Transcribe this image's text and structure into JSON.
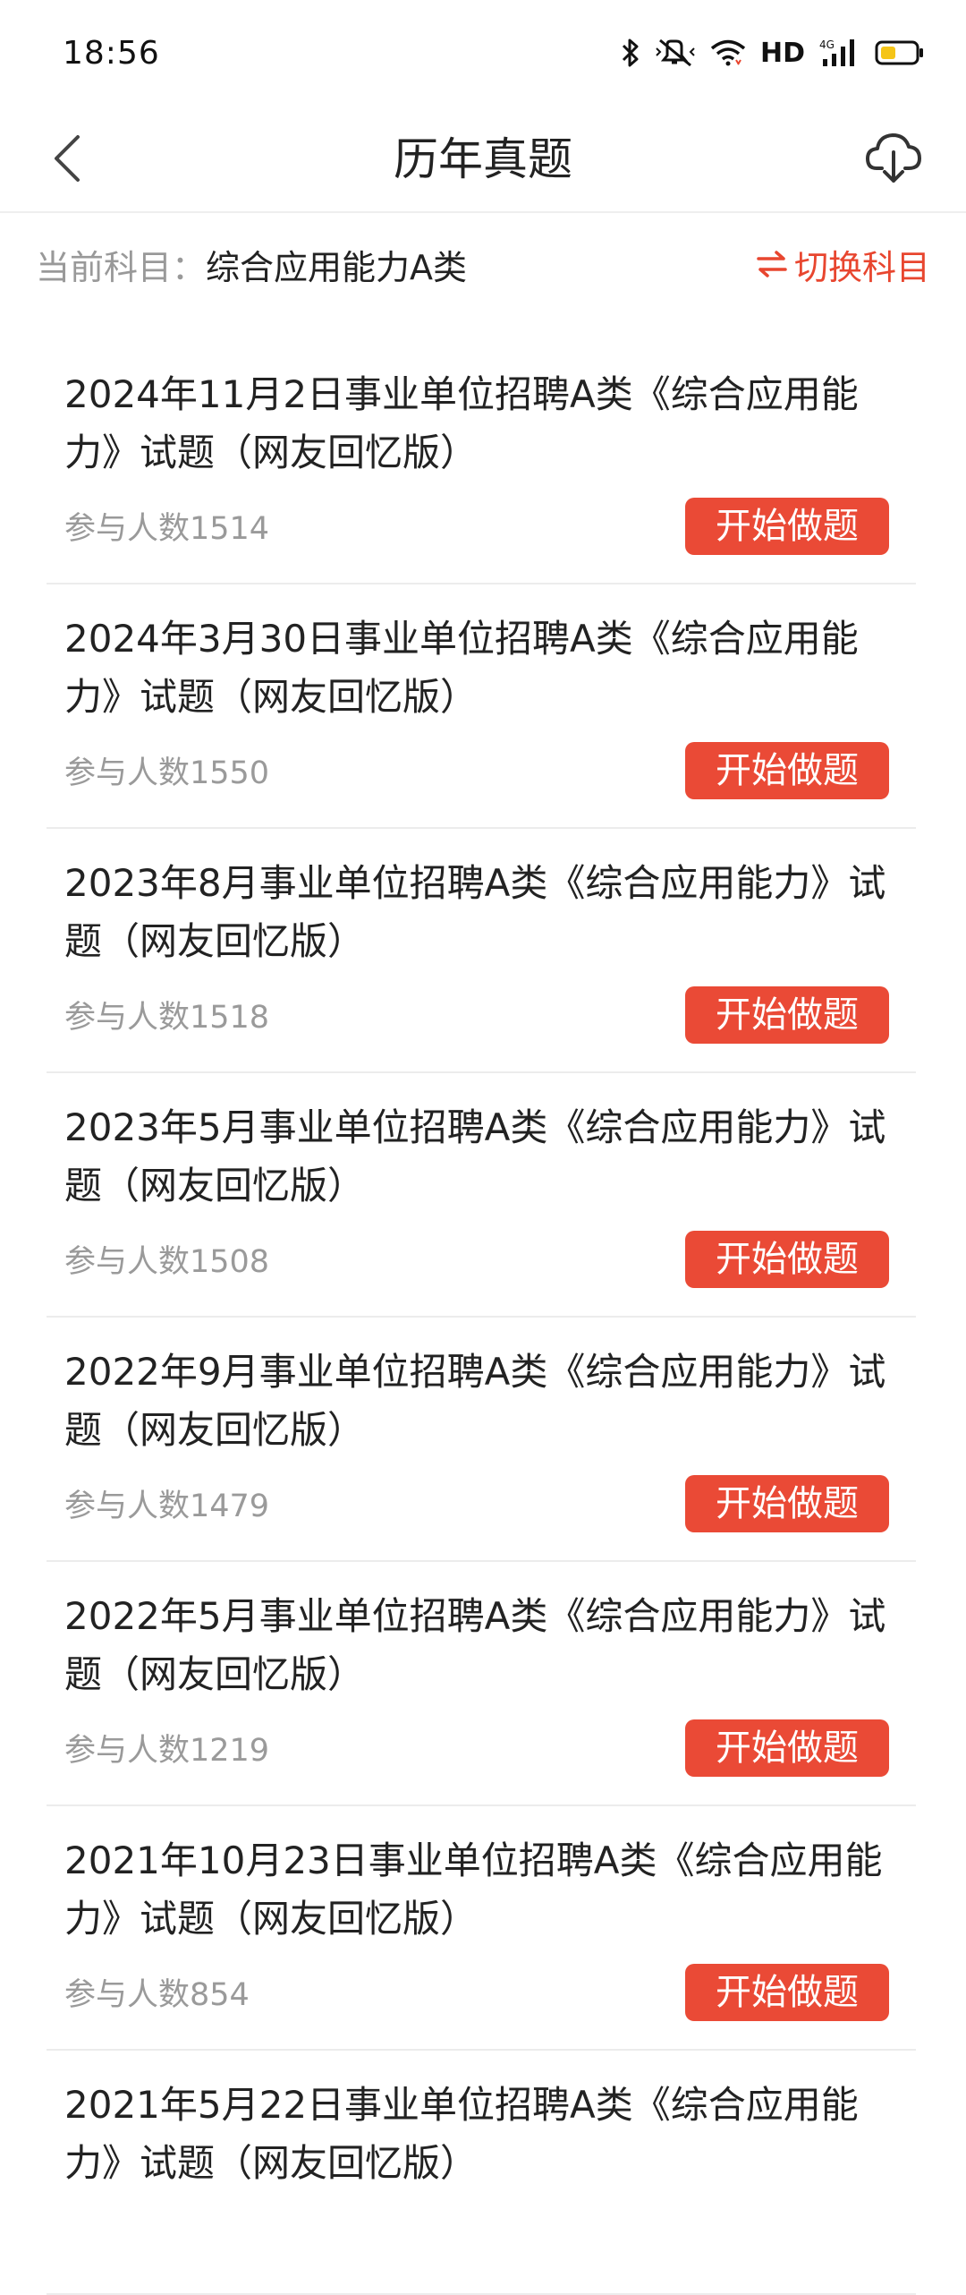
{
  "status_bar": {
    "time": "18:56",
    "network_label": "HD",
    "icons": [
      "bluetooth-icon",
      "mute-icon",
      "wifi-icon",
      "signal-4g-icon",
      "battery-icon"
    ],
    "battery_color": "#f5c518",
    "wifi_color": "#e8462f"
  },
  "nav": {
    "title": "历年真题",
    "back_icon": "chevron-left-icon",
    "download_icon": "cloud-download-icon"
  },
  "subject": {
    "prefix": "当前科目：",
    "value": "综合应用能力A类",
    "switch_icon": "swap-arrows-icon",
    "switch_label": "切换科目"
  },
  "accent_color": "#ea4a36",
  "items": [
    {
      "title": "2024年11月2日事业单位招聘A类《综合应用能力》试题（网友回忆版）",
      "count_label": "参与人数1514",
      "button": "开始做题"
    },
    {
      "title": "2024年3月30日事业单位招聘A类《综合应用能力》试题（网友回忆版）",
      "count_label": "参与人数1550",
      "button": "开始做题"
    },
    {
      "title": "2023年8月事业单位招聘A类《综合应用能力》试题（网友回忆版）",
      "count_label": "参与人数1518",
      "button": "开始做题"
    },
    {
      "title": "2023年5月事业单位招聘A类《综合应用能力》试题（网友回忆版）",
      "count_label": "参与人数1508",
      "button": "开始做题"
    },
    {
      "title": "2022年9月事业单位招聘A类《综合应用能力》试题（网友回忆版）",
      "count_label": "参与人数1479",
      "button": "开始做题"
    },
    {
      "title": "2022年5月事业单位招聘A类《综合应用能力》试题（网友回忆版）",
      "count_label": "参与人数1219",
      "button": "开始做题"
    },
    {
      "title": "2021年10月23日事业单位招聘A类《综合应用能力》试题（网友回忆版）",
      "count_label": "参与人数854",
      "button": "开始做题"
    },
    {
      "title": "2021年5月22日事业单位招聘A类《综合应用能力》试题（网友回忆版）",
      "count_label": "",
      "button": ""
    }
  ]
}
